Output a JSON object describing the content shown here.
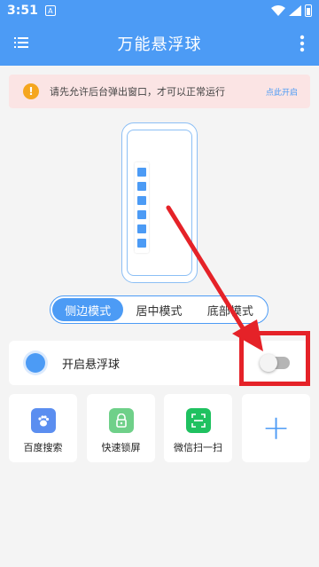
{
  "status_bar": {
    "time": "3:51"
  },
  "app_bar": {
    "title": "万能悬浮球"
  },
  "banner": {
    "message": "请先允许后台弹出窗口，才可以正常运行",
    "action": "点此开启",
    "icon_text": "!"
  },
  "modes": {
    "items": [
      "侧边模式",
      "居中模式",
      "底部模式"
    ],
    "selected": "侧边模式"
  },
  "toggle": {
    "label": "开启悬浮球",
    "enabled": false
  },
  "tools": [
    {
      "label": "百度搜索",
      "icon": "baidu-paw-icon",
      "color": "#5b8ef0"
    },
    {
      "label": "快速锁屏",
      "icon": "lock-icon",
      "color": "#6fd089"
    },
    {
      "label": "微信扫一扫",
      "icon": "scan-icon",
      "color": "#1fc160"
    },
    {
      "label": "+",
      "icon": "add-icon",
      "color": "#4c9bf5"
    }
  ],
  "colors": {
    "primary": "#4c9bf5",
    "banner_bg": "#fbe4e4",
    "warning": "#f5a61f",
    "annotation": "#e52228"
  }
}
